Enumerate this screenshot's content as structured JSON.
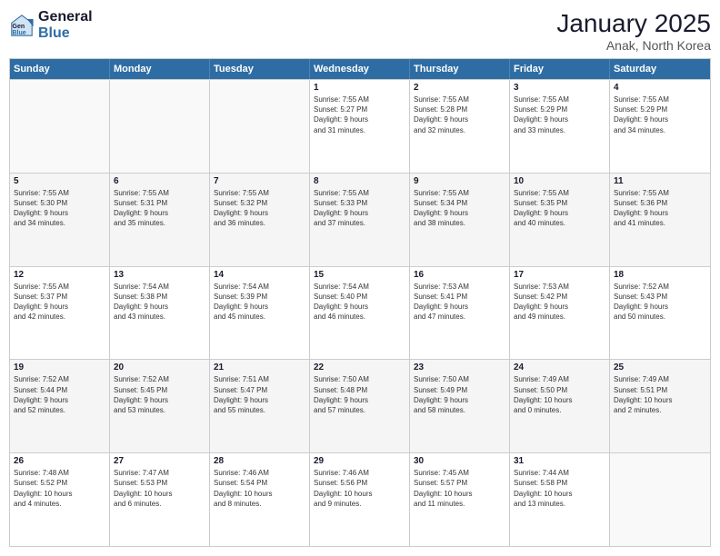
{
  "header": {
    "logo_line1": "General",
    "logo_line2": "Blue",
    "title": "January 2025",
    "subtitle": "Anak, North Korea"
  },
  "weekdays": [
    "Sunday",
    "Monday",
    "Tuesday",
    "Wednesday",
    "Thursday",
    "Friday",
    "Saturday"
  ],
  "rows": [
    [
      {
        "day": "",
        "lines": []
      },
      {
        "day": "",
        "lines": []
      },
      {
        "day": "",
        "lines": []
      },
      {
        "day": "1",
        "lines": [
          "Sunrise: 7:55 AM",
          "Sunset: 5:27 PM",
          "Daylight: 9 hours",
          "and 31 minutes."
        ]
      },
      {
        "day": "2",
        "lines": [
          "Sunrise: 7:55 AM",
          "Sunset: 5:28 PM",
          "Daylight: 9 hours",
          "and 32 minutes."
        ]
      },
      {
        "day": "3",
        "lines": [
          "Sunrise: 7:55 AM",
          "Sunset: 5:29 PM",
          "Daylight: 9 hours",
          "and 33 minutes."
        ]
      },
      {
        "day": "4",
        "lines": [
          "Sunrise: 7:55 AM",
          "Sunset: 5:29 PM",
          "Daylight: 9 hours",
          "and 34 minutes."
        ]
      }
    ],
    [
      {
        "day": "5",
        "lines": [
          "Sunrise: 7:55 AM",
          "Sunset: 5:30 PM",
          "Daylight: 9 hours",
          "and 34 minutes."
        ]
      },
      {
        "day": "6",
        "lines": [
          "Sunrise: 7:55 AM",
          "Sunset: 5:31 PM",
          "Daylight: 9 hours",
          "and 35 minutes."
        ]
      },
      {
        "day": "7",
        "lines": [
          "Sunrise: 7:55 AM",
          "Sunset: 5:32 PM",
          "Daylight: 9 hours",
          "and 36 minutes."
        ]
      },
      {
        "day": "8",
        "lines": [
          "Sunrise: 7:55 AM",
          "Sunset: 5:33 PM",
          "Daylight: 9 hours",
          "and 37 minutes."
        ]
      },
      {
        "day": "9",
        "lines": [
          "Sunrise: 7:55 AM",
          "Sunset: 5:34 PM",
          "Daylight: 9 hours",
          "and 38 minutes."
        ]
      },
      {
        "day": "10",
        "lines": [
          "Sunrise: 7:55 AM",
          "Sunset: 5:35 PM",
          "Daylight: 9 hours",
          "and 40 minutes."
        ]
      },
      {
        "day": "11",
        "lines": [
          "Sunrise: 7:55 AM",
          "Sunset: 5:36 PM",
          "Daylight: 9 hours",
          "and 41 minutes."
        ]
      }
    ],
    [
      {
        "day": "12",
        "lines": [
          "Sunrise: 7:55 AM",
          "Sunset: 5:37 PM",
          "Daylight: 9 hours",
          "and 42 minutes."
        ]
      },
      {
        "day": "13",
        "lines": [
          "Sunrise: 7:54 AM",
          "Sunset: 5:38 PM",
          "Daylight: 9 hours",
          "and 43 minutes."
        ]
      },
      {
        "day": "14",
        "lines": [
          "Sunrise: 7:54 AM",
          "Sunset: 5:39 PM",
          "Daylight: 9 hours",
          "and 45 minutes."
        ]
      },
      {
        "day": "15",
        "lines": [
          "Sunrise: 7:54 AM",
          "Sunset: 5:40 PM",
          "Daylight: 9 hours",
          "and 46 minutes."
        ]
      },
      {
        "day": "16",
        "lines": [
          "Sunrise: 7:53 AM",
          "Sunset: 5:41 PM",
          "Daylight: 9 hours",
          "and 47 minutes."
        ]
      },
      {
        "day": "17",
        "lines": [
          "Sunrise: 7:53 AM",
          "Sunset: 5:42 PM",
          "Daylight: 9 hours",
          "and 49 minutes."
        ]
      },
      {
        "day": "18",
        "lines": [
          "Sunrise: 7:52 AM",
          "Sunset: 5:43 PM",
          "Daylight: 9 hours",
          "and 50 minutes."
        ]
      }
    ],
    [
      {
        "day": "19",
        "lines": [
          "Sunrise: 7:52 AM",
          "Sunset: 5:44 PM",
          "Daylight: 9 hours",
          "and 52 minutes."
        ]
      },
      {
        "day": "20",
        "lines": [
          "Sunrise: 7:52 AM",
          "Sunset: 5:45 PM",
          "Daylight: 9 hours",
          "and 53 minutes."
        ]
      },
      {
        "day": "21",
        "lines": [
          "Sunrise: 7:51 AM",
          "Sunset: 5:47 PM",
          "Daylight: 9 hours",
          "and 55 minutes."
        ]
      },
      {
        "day": "22",
        "lines": [
          "Sunrise: 7:50 AM",
          "Sunset: 5:48 PM",
          "Daylight: 9 hours",
          "and 57 minutes."
        ]
      },
      {
        "day": "23",
        "lines": [
          "Sunrise: 7:50 AM",
          "Sunset: 5:49 PM",
          "Daylight: 9 hours",
          "and 58 minutes."
        ]
      },
      {
        "day": "24",
        "lines": [
          "Sunrise: 7:49 AM",
          "Sunset: 5:50 PM",
          "Daylight: 10 hours",
          "and 0 minutes."
        ]
      },
      {
        "day": "25",
        "lines": [
          "Sunrise: 7:49 AM",
          "Sunset: 5:51 PM",
          "Daylight: 10 hours",
          "and 2 minutes."
        ]
      }
    ],
    [
      {
        "day": "26",
        "lines": [
          "Sunrise: 7:48 AM",
          "Sunset: 5:52 PM",
          "Daylight: 10 hours",
          "and 4 minutes."
        ]
      },
      {
        "day": "27",
        "lines": [
          "Sunrise: 7:47 AM",
          "Sunset: 5:53 PM",
          "Daylight: 10 hours",
          "and 6 minutes."
        ]
      },
      {
        "day": "28",
        "lines": [
          "Sunrise: 7:46 AM",
          "Sunset: 5:54 PM",
          "Daylight: 10 hours",
          "and 8 minutes."
        ]
      },
      {
        "day": "29",
        "lines": [
          "Sunrise: 7:46 AM",
          "Sunset: 5:56 PM",
          "Daylight: 10 hours",
          "and 9 minutes."
        ]
      },
      {
        "day": "30",
        "lines": [
          "Sunrise: 7:45 AM",
          "Sunset: 5:57 PM",
          "Daylight: 10 hours",
          "and 11 minutes."
        ]
      },
      {
        "day": "31",
        "lines": [
          "Sunrise: 7:44 AM",
          "Sunset: 5:58 PM",
          "Daylight: 10 hours",
          "and 13 minutes."
        ]
      },
      {
        "day": "",
        "lines": []
      }
    ]
  ]
}
